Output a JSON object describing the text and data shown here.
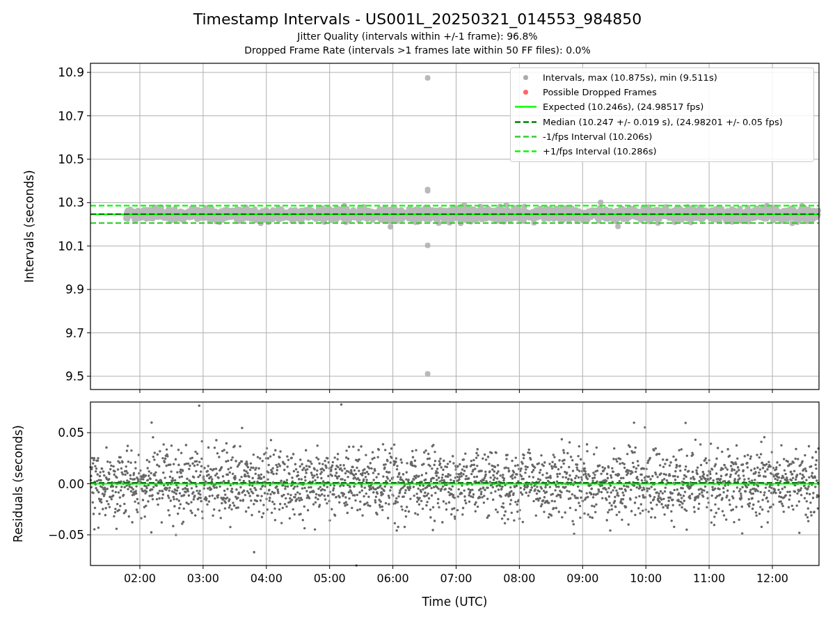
{
  "figure": {
    "title": "Timestamp Intervals - US001L_20250321_014553_984850",
    "subtitles": [
      "Jitter Quality (intervals within +/-1 frame): 96.8%",
      "Dropped Frame Rate (intervals >1 frames late within 50 FF files): 0.0%"
    ]
  },
  "intervals_panel": {
    "chart_data": {
      "type": "line",
      "ylabel": "Intervals (seconds)",
      "grid": true,
      "legend": "upper right",
      "x": [
        1.219,
        12.737
      ],
      "xlim": [
        1.219,
        12.737
      ],
      "ylim": [
        9.439,
        10.942
      ],
      "yticks": [
        {
          "value": 9.5,
          "label": "9.5"
        },
        {
          "value": 9.7,
          "label": "9.7"
        },
        {
          "value": 9.9,
          "label": "9.9"
        },
        {
          "value": 10.1,
          "label": "10.1"
        },
        {
          "value": 10.3,
          "label": "10.3"
        },
        {
          "value": 10.5,
          "label": "10.5"
        },
        {
          "value": 10.7,
          "label": "10.7"
        },
        {
          "value": 10.9,
          "label": "10.9"
        }
      ],
      "series": [
        {
          "name": "Expected (10.246s), (24.98517 fps)",
          "color": "#00ff00",
          "line_style": "solid",
          "values": [
            10.246,
            10.246
          ]
        },
        {
          "name": "Median (10.247 +/- 0.019 s), (24.98201 +/- 0.05 fps)",
          "color": "#008000",
          "line_style": "dashed",
          "values": [
            10.247,
            10.247
          ]
        },
        {
          "name": "-1/fps Interval (10.206s)",
          "color": "#32cd32",
          "line_style": "dashed",
          "values": [
            10.206,
            10.206
          ]
        },
        {
          "name": "+1/fps Interval (10.286s)",
          "color": "#00ff00",
          "line_style": "dashed",
          "values": [
            10.286,
            10.286
          ]
        }
      ]
    },
    "legend": [
      {
        "kind": "marker",
        "label": "Intervals, max (10.875s), min (9.511s)",
        "color": "#aaaaaa"
      },
      {
        "kind": "marker",
        "label": "Possible Dropped Frames",
        "color": "#ff6666"
      }
    ]
  },
  "residuals_panel": {
    "chart_data": {
      "type": "line",
      "xlabel": "Time (UTC)",
      "ylabel": "Residuals (seconds)",
      "grid": true,
      "x": [
        1.219,
        12.737
      ],
      "xlim": [
        1.219,
        12.737
      ],
      "ylim": [
        -0.08,
        0.08
      ],
      "xticks": [
        {
          "value": 2,
          "label": "02:00"
        },
        {
          "value": 3,
          "label": "03:00"
        },
        {
          "value": 4,
          "label": "04:00"
        },
        {
          "value": 5,
          "label": "05:00"
        },
        {
          "value": 6,
          "label": "06:00"
        },
        {
          "value": 7,
          "label": "07:00"
        },
        {
          "value": 8,
          "label": "08:00"
        },
        {
          "value": 9,
          "label": "09:00"
        },
        {
          "value": 10,
          "label": "10:00"
        },
        {
          "value": 11,
          "label": "11:00"
        },
        {
          "value": 12,
          "label": "12:00"
        }
      ],
      "yticks": [
        {
          "value": -0.05,
          "label": "−0.05"
        },
        {
          "value": 0,
          "label": "0.00"
        },
        {
          "value": 0.05,
          "label": "0.05"
        }
      ],
      "series": [
        {
          "color": "#00ff00",
          "line_style": "solid",
          "values": [
            0,
            0
          ]
        },
        {
          "color": "#008000",
          "line_style": "dashed",
          "values": [
            0.001,
            0.001
          ]
        }
      ]
    }
  }
}
